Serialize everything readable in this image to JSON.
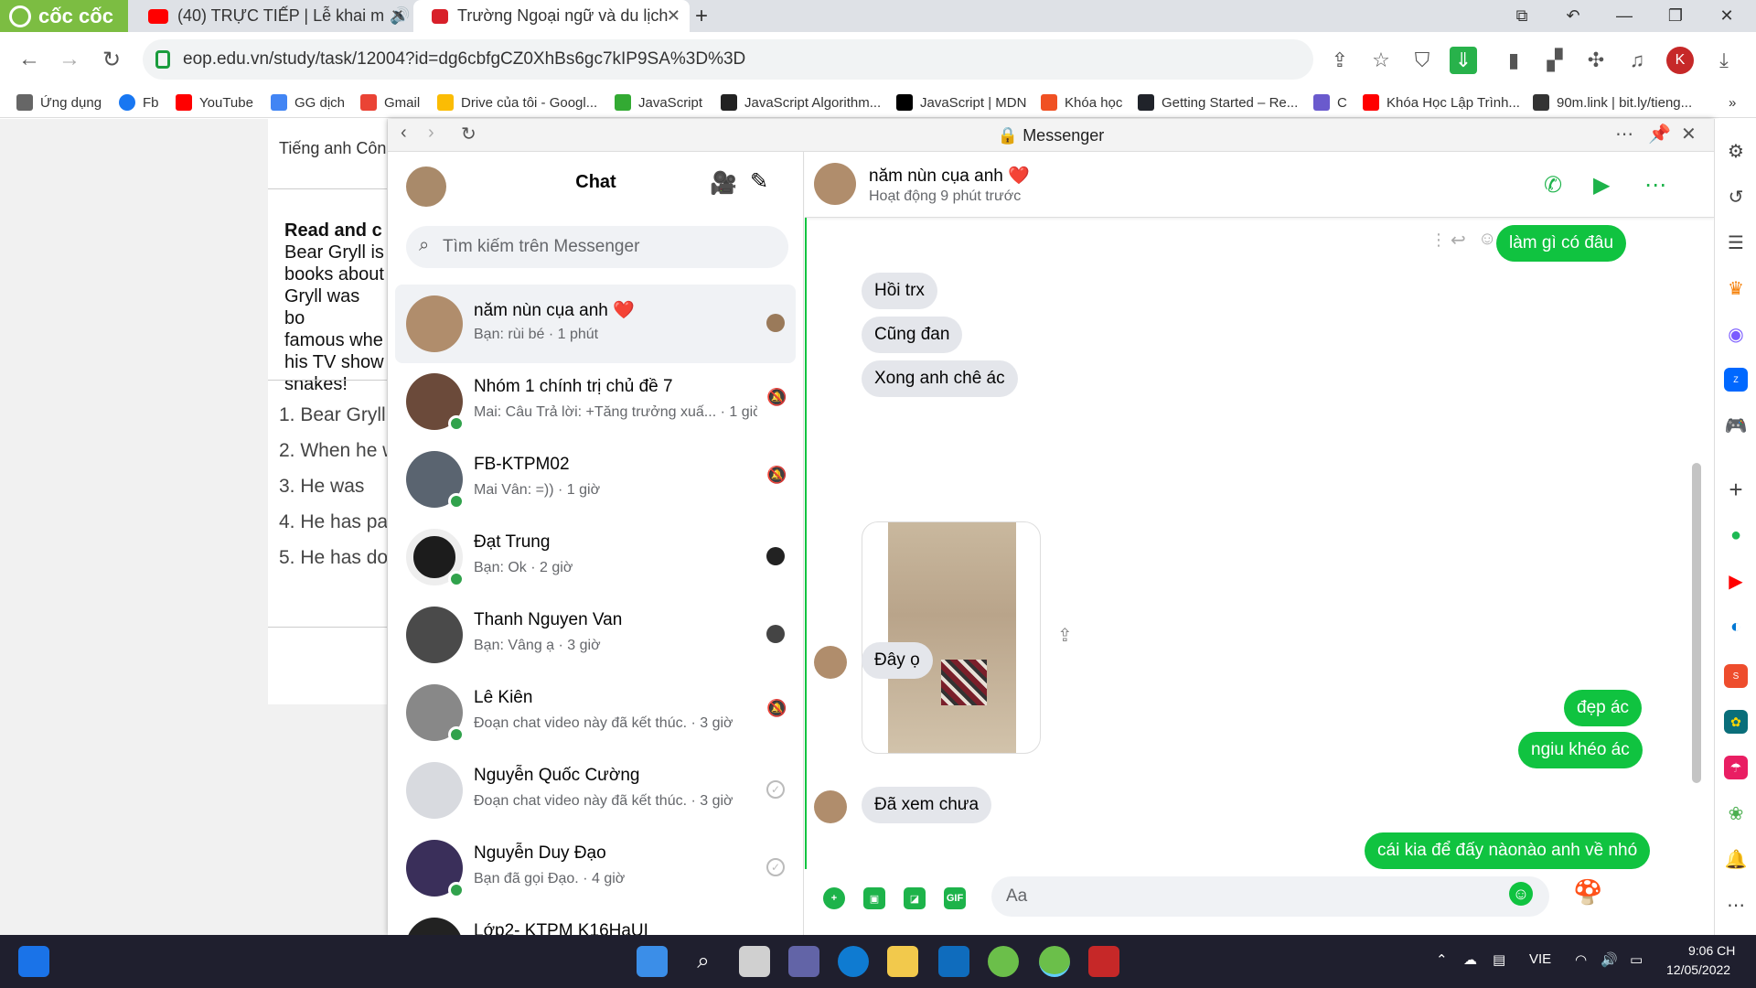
{
  "browser": {
    "brand": "cốc cốc",
    "tabs": [
      {
        "title": "(40) TRỰC TIẾP | Lễ khai m",
        "favicon": "youtube-icon",
        "active": false
      },
      {
        "title": "Trường Ngoại ngữ và du lịch",
        "favicon": "school-icon",
        "active": true
      }
    ],
    "new_tab": "+",
    "url": "eop.edu.vn/study/task/12004?id=dg6cbfgCZ0XhBs6gc7kIP9SA%3D%3D",
    "profile_initial": "K",
    "bookmarks": [
      "Ứng dụng",
      "Fb",
      "YouTube",
      "GG dịch",
      "Gmail",
      "Drive của tôi - Googl...",
      "JavaScript",
      "JavaScript Algorithm...",
      "JavaScript | MDN",
      "Khóa học",
      "Getting Started – Re...",
      "C",
      "Khóa Học Lập Trình...",
      "90m.link | bit.ly/tieng..."
    ],
    "bookmarks_more": "»"
  },
  "webpage": {
    "tab_label": "Tiếng anh Côn",
    "heading": "Read and c",
    "paragraph": [
      "Bear Gryll is",
      "books about",
      "Gryll was bo",
      "famous whe",
      "his TV show",
      "snakes!"
    ],
    "questions": [
      "1. Bear Gryll",
      "2. When he w",
      "3. He was",
      "4. He has pa",
      "5. He has do"
    ]
  },
  "messenger": {
    "window_title": "Messenger",
    "chat_list": {
      "title": "Chat",
      "search_placeholder": "Tìm kiếm trên Messenger",
      "conversations": [
        {
          "name": "năm nùn cụa anh ❤️",
          "preview": "Bạn: rùi bé · 1 phút",
          "online": false,
          "status": "seen-avatar"
        },
        {
          "name": "Nhóm 1 chính trị chủ đề 7",
          "preview": "Mai: Câu Trả lời: +Tăng trưởng xuấ... · 1 giờ",
          "online": true,
          "status": "muted-icon"
        },
        {
          "name": "FB-KTPM02",
          "preview": "Mai Vân: =)) · 1 giờ",
          "online": true,
          "status": "muted-icon"
        },
        {
          "name": "Đạt Trung",
          "preview": "Bạn: Ok · 2 giờ",
          "online": true,
          "status": "seen-avatar"
        },
        {
          "name": "Thanh Nguyen Van",
          "preview": "Bạn: Vâng ạ · 3 giờ",
          "online": false,
          "status": "seen-avatar"
        },
        {
          "name": "Lê Kiên",
          "preview": "Đoạn chat video này đã kết thúc. · 3 giờ",
          "online": true,
          "status": "muted-icon"
        },
        {
          "name": "Nguyễn Quốc Cường",
          "preview": "Đoạn chat video này đã kết thúc. · 3 giờ",
          "online": false,
          "status": "sent-check-icon"
        },
        {
          "name": "Nguyễn Duy Đạo",
          "preview": "Bạn đã gọi Đạo. · 4 giờ",
          "online": true,
          "status": "sent-check-icon"
        },
        {
          "name": "Lớp2- KTPM K16HaUI",
          "preview": "",
          "online": false,
          "status": ""
        }
      ]
    },
    "conversation": {
      "name": "năm nùn cụa anh ❤️",
      "status": "Hoạt động 9 phút trước",
      "messages": [
        {
          "side": "sent",
          "text": "làm gì có đâu"
        },
        {
          "side": "recv",
          "text": "Hồi trx"
        },
        {
          "side": "recv",
          "text": "Cũng đan"
        },
        {
          "side": "recv",
          "text": "Xong anh chê ác"
        },
        {
          "side": "recv",
          "text": "Đây ọ"
        },
        {
          "side": "sent",
          "text": "đẹp ác"
        },
        {
          "side": "sent",
          "text": "ngiu khéo ác"
        },
        {
          "side": "recv",
          "text": "Đã xem chưa"
        },
        {
          "side": "sent",
          "text": "cái kia để đấy nàonào anh về nhó"
        }
      ],
      "input_placeholder": "Aa",
      "gif_label": "GIF"
    }
  },
  "taskbar": {
    "language": "VIE",
    "time": "9:06 CH",
    "date": "12/05/2022"
  },
  "colors": {
    "brand": "#7cbd42",
    "accent_green": "#10c340",
    "online": "#31a24c"
  }
}
